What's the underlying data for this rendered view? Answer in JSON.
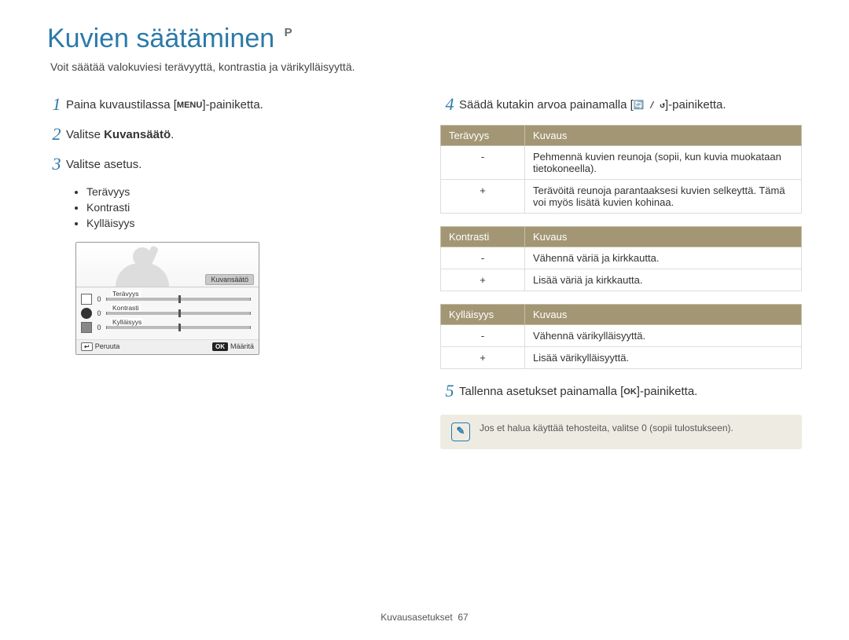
{
  "header": {
    "title": "Kuvien säätäminen",
    "mode_badge": "P",
    "intro": "Voit säätää valokuviesi terävyyttä, kontrastia ja värikylläisyyttä."
  },
  "left": {
    "steps": [
      {
        "num": "1",
        "pre": "Paina kuvaustilassa [",
        "key": "MENU",
        "post": "]-painiketta."
      },
      {
        "num": "2",
        "pre": "Valitse ",
        "bold": "Kuvansäätö",
        "post": "."
      },
      {
        "num": "3",
        "pre": "Valitse asetus.",
        "key": "",
        "post": ""
      }
    ],
    "bullets": [
      "Terävyys",
      "Kontrasti",
      "Kylläisyys"
    ],
    "screen": {
      "tag": "Kuvansäätö",
      "rows": [
        {
          "label": "Terävyys",
          "value": "0"
        },
        {
          "label": "Kontrasti",
          "value": "0"
        },
        {
          "label": "Kylläisyys",
          "value": "0"
        }
      ],
      "back_key": "↩",
      "back": "Peruuta",
      "ok_key": "OK",
      "ok": "Määritä"
    }
  },
  "right": {
    "step4": {
      "num": "4",
      "pre": "Säädä kutakin arvoa painamalla [",
      "key": "🔄 / ↺",
      "post": "]-painiketta."
    },
    "tables": [
      {
        "h1": "Terävyys",
        "h2": "Kuvaus",
        "rows": [
          {
            "sym": "-",
            "desc": "Pehmennä kuvien reunoja (sopii, kun kuvia muokataan tietokoneella)."
          },
          {
            "sym": "+",
            "desc": "Terävöitä reunoja parantaaksesi kuvien selkeyttä. Tämä voi myös lisätä kuvien kohinaa."
          }
        ]
      },
      {
        "h1": "Kontrasti",
        "h2": "Kuvaus",
        "rows": [
          {
            "sym": "-",
            "desc": "Vähennä väriä ja kirkkautta."
          },
          {
            "sym": "+",
            "desc": "Lisää väriä ja kirkkautta."
          }
        ]
      },
      {
        "h1": "Kylläisyys",
        "h2": "Kuvaus",
        "rows": [
          {
            "sym": "-",
            "desc": "Vähennä värikylläisyyttä."
          },
          {
            "sym": "+",
            "desc": "Lisää värikylläisyyttä."
          }
        ]
      }
    ],
    "step5": {
      "num": "5",
      "pre": "Tallenna asetukset painamalla [",
      "key": "OK",
      "post": "]-painiketta."
    },
    "note": "Jos et halua käyttää tehosteita, valitse 0 (sopii tulostukseen)."
  },
  "footer": {
    "section": "Kuvausasetukset",
    "page": "67"
  }
}
